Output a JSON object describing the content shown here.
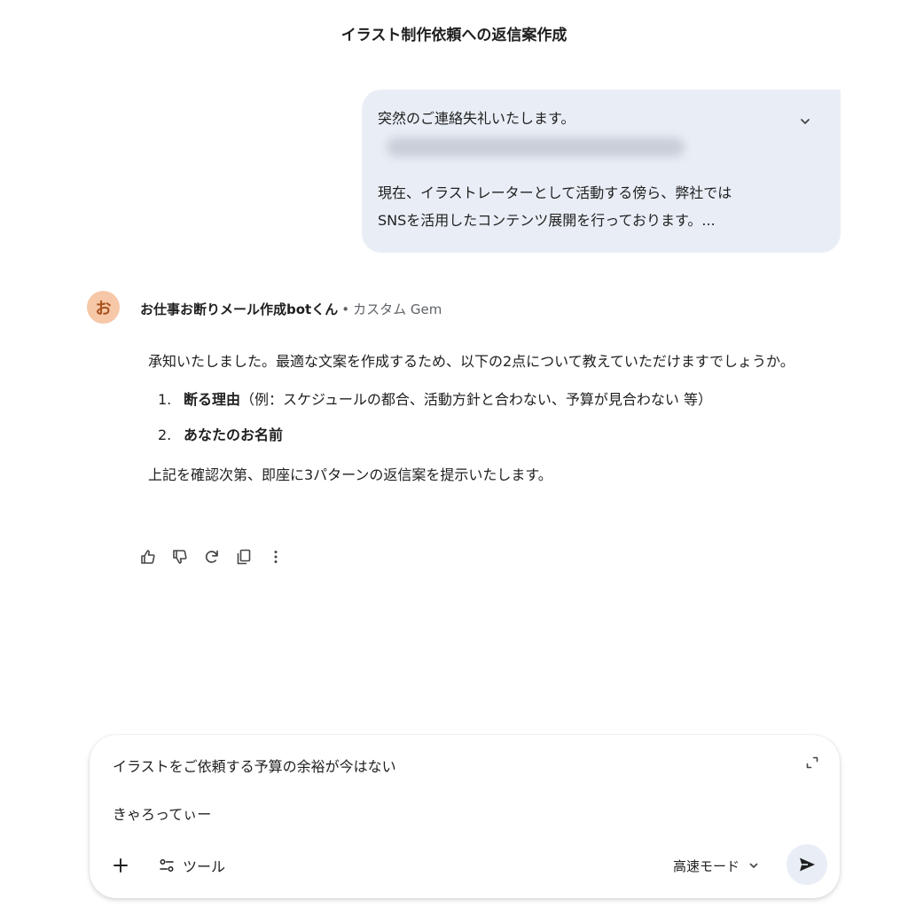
{
  "header": {
    "title": "イラスト制作依頼への返信案作成"
  },
  "user_message": {
    "line1": "突然のご連絡失礼いたします。",
    "line3": "現在、イラストレーターとして活動する傍ら、弊社では",
    "line4": "SNSを活用したコンテンツ展開を行っております。..."
  },
  "bot": {
    "avatar_char": "お",
    "name": "お仕事お断りメール作成botくん",
    "separator": "•",
    "tag": "カスタム Gem"
  },
  "response": {
    "intro": "承知いたしました。最適な文案を作成するため、以下の2点について教えていただけますでしょうか。",
    "items": [
      {
        "num": "1.",
        "bold": "断る理由",
        "rest": "（例：スケジュールの都合、活動方針と合わない、予算が見合わない 等）"
      },
      {
        "num": "2.",
        "bold": "あなたのお名前",
        "rest": ""
      }
    ],
    "closing": "上記を確認次第、即座に3パターンの返信案を提示いたします。"
  },
  "composer": {
    "line1": "イラストをご依頼する予算の余裕が今はない",
    "line2": "きゃろってぃー",
    "tools_label": "ツール",
    "mode_label": "高速モード"
  },
  "colors": {
    "bubble_bg": "#e9eef6",
    "avatar_bg": "#f6c8a8",
    "avatar_fg": "#a9521e",
    "secondary_text": "#5f6368"
  },
  "icons": {
    "expand": "chevron-down-icon",
    "thumbs_up": "thumbs-up-icon",
    "thumbs_down": "thumbs-down-icon",
    "regenerate": "refresh-icon",
    "copy": "copy-icon",
    "more": "more-vertical-icon",
    "fullscreen": "expand-icon",
    "add": "plus-icon",
    "tools": "tools-icon",
    "mode_dropdown": "chevron-down-icon",
    "send": "send-icon"
  }
}
